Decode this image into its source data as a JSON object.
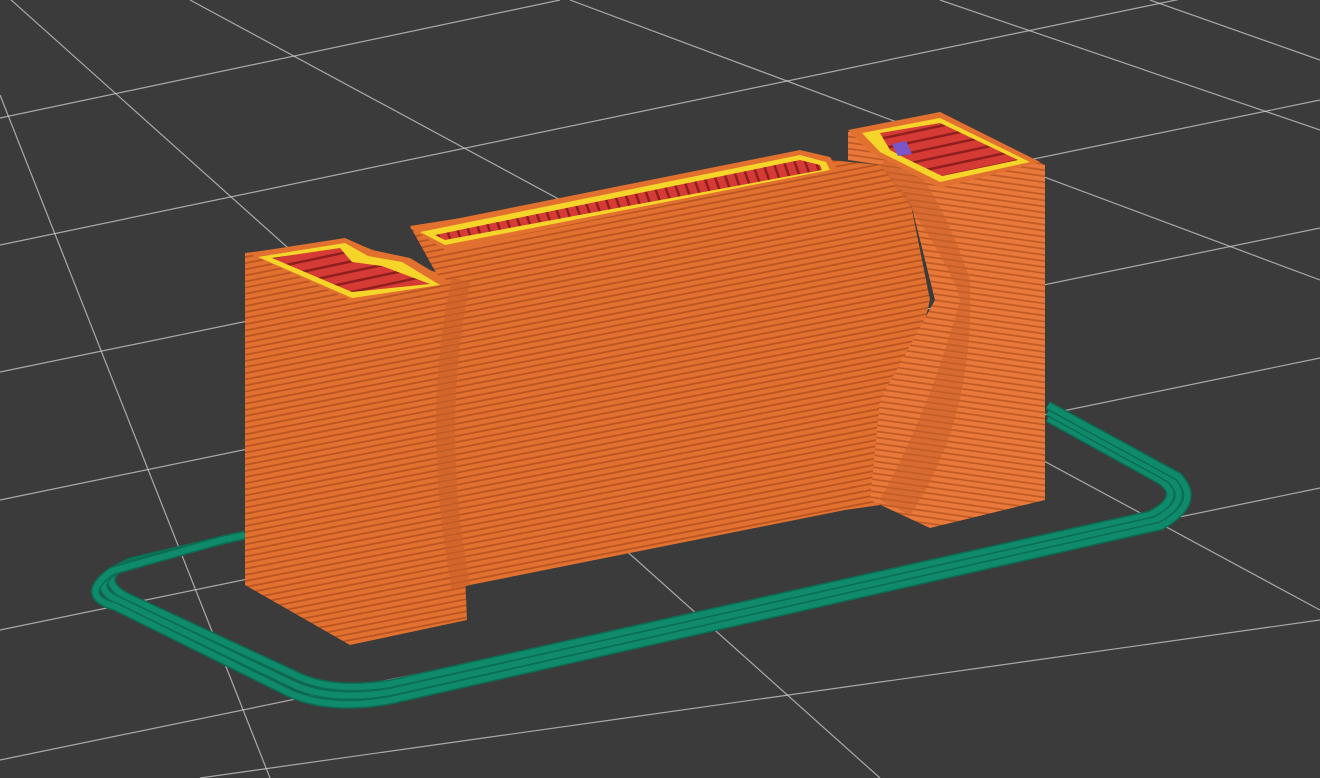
{
  "viewport": {
    "background_color": "#3b3b3b",
    "grid_color": "#cfcfcf",
    "view_type": "3D G-code layer preview"
  },
  "toolpaths": {
    "external_perimeter": {
      "name": "external-perimeter",
      "color": "#e2702f"
    },
    "perimeter": {
      "name": "perimeter",
      "color": "#f5d52a"
    },
    "solid_infill": {
      "name": "solid-infill",
      "color": "#d63a35"
    },
    "skirt": {
      "name": "skirt",
      "color": "#0f8a6a"
    },
    "travel_marker": {
      "name": "travel-marker",
      "color": "#7a57c8"
    }
  }
}
